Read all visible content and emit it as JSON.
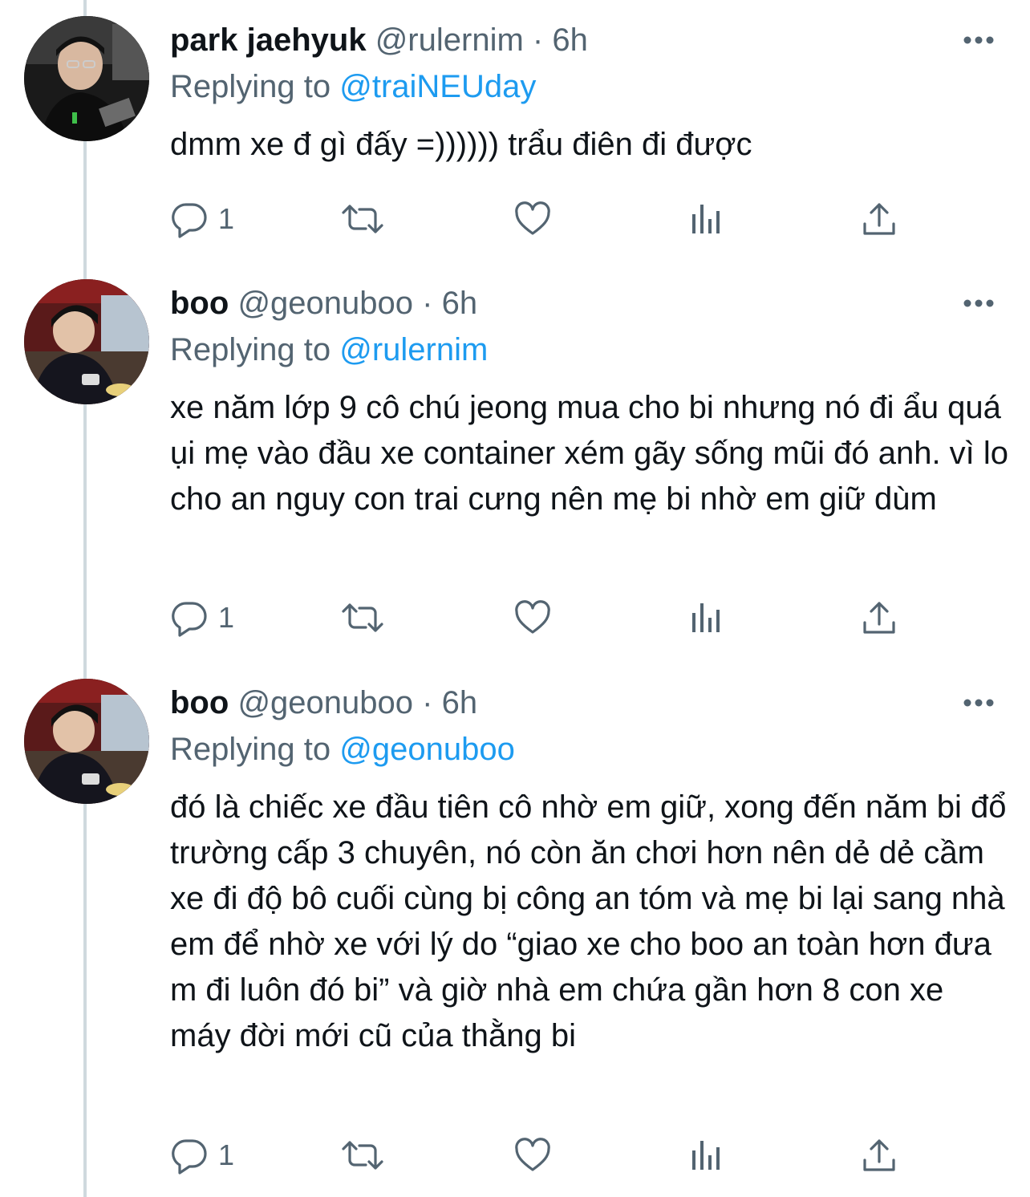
{
  "tweets": [
    {
      "name": "park jaehyuk",
      "handle": "@rulernim",
      "dot": "·",
      "time": "6h",
      "replying_prefix": "Replying to",
      "replying_to": "@traiNEUday",
      "text": "dmm xe đ gì đấy =)))))) trẩu điên đi được",
      "reply_count": "1"
    },
    {
      "name": "boo",
      "handle": "@geonuboo",
      "dot": "·",
      "time": "6h",
      "replying_prefix": "Replying to",
      "replying_to": "@rulernim",
      "text": "xe năm lớp 9 cô chú jeong mua cho bi nhưng nó đi ẩu quá ụi mẹ vào đầu xe container xém gãy sống mũi đó anh. vì lo cho an nguy con trai cưng nên mẹ bi nhờ em giữ dùm",
      "reply_count": "1"
    },
    {
      "name": "boo",
      "handle": "@geonuboo",
      "dot": "·",
      "time": "6h",
      "replying_prefix": "Replying to",
      "replying_to": "@geonuboo",
      "text": "đó là chiếc xe đầu tiên cô nhờ em giữ, xong đến năm bi đổ trường cấp 3 chuyên, nó còn ăn chơi hơn nên dẻ dẻ cầm xe đi độ bô cuối cùng bị công an tóm và mẹ bi lại sang nhà em để nhờ xe với lý do “giao xe cho boo an toàn hơn đưa m đi luôn đó bi” và giờ nhà em chứa gần hơn 8 con xe máy đời mới cũ của thằng bi",
      "reply_count": "1"
    }
  ],
  "icons": {
    "more": "more-horizontal-icon",
    "reply": "reply-icon",
    "retweet": "retweet-icon",
    "like": "heart-icon",
    "analytics": "analytics-icon",
    "share": "share-icon"
  },
  "colors": {
    "text": "#0f1419",
    "secondary": "#536471",
    "link": "#1d9bf0",
    "thread_line": "#cfd9de"
  }
}
